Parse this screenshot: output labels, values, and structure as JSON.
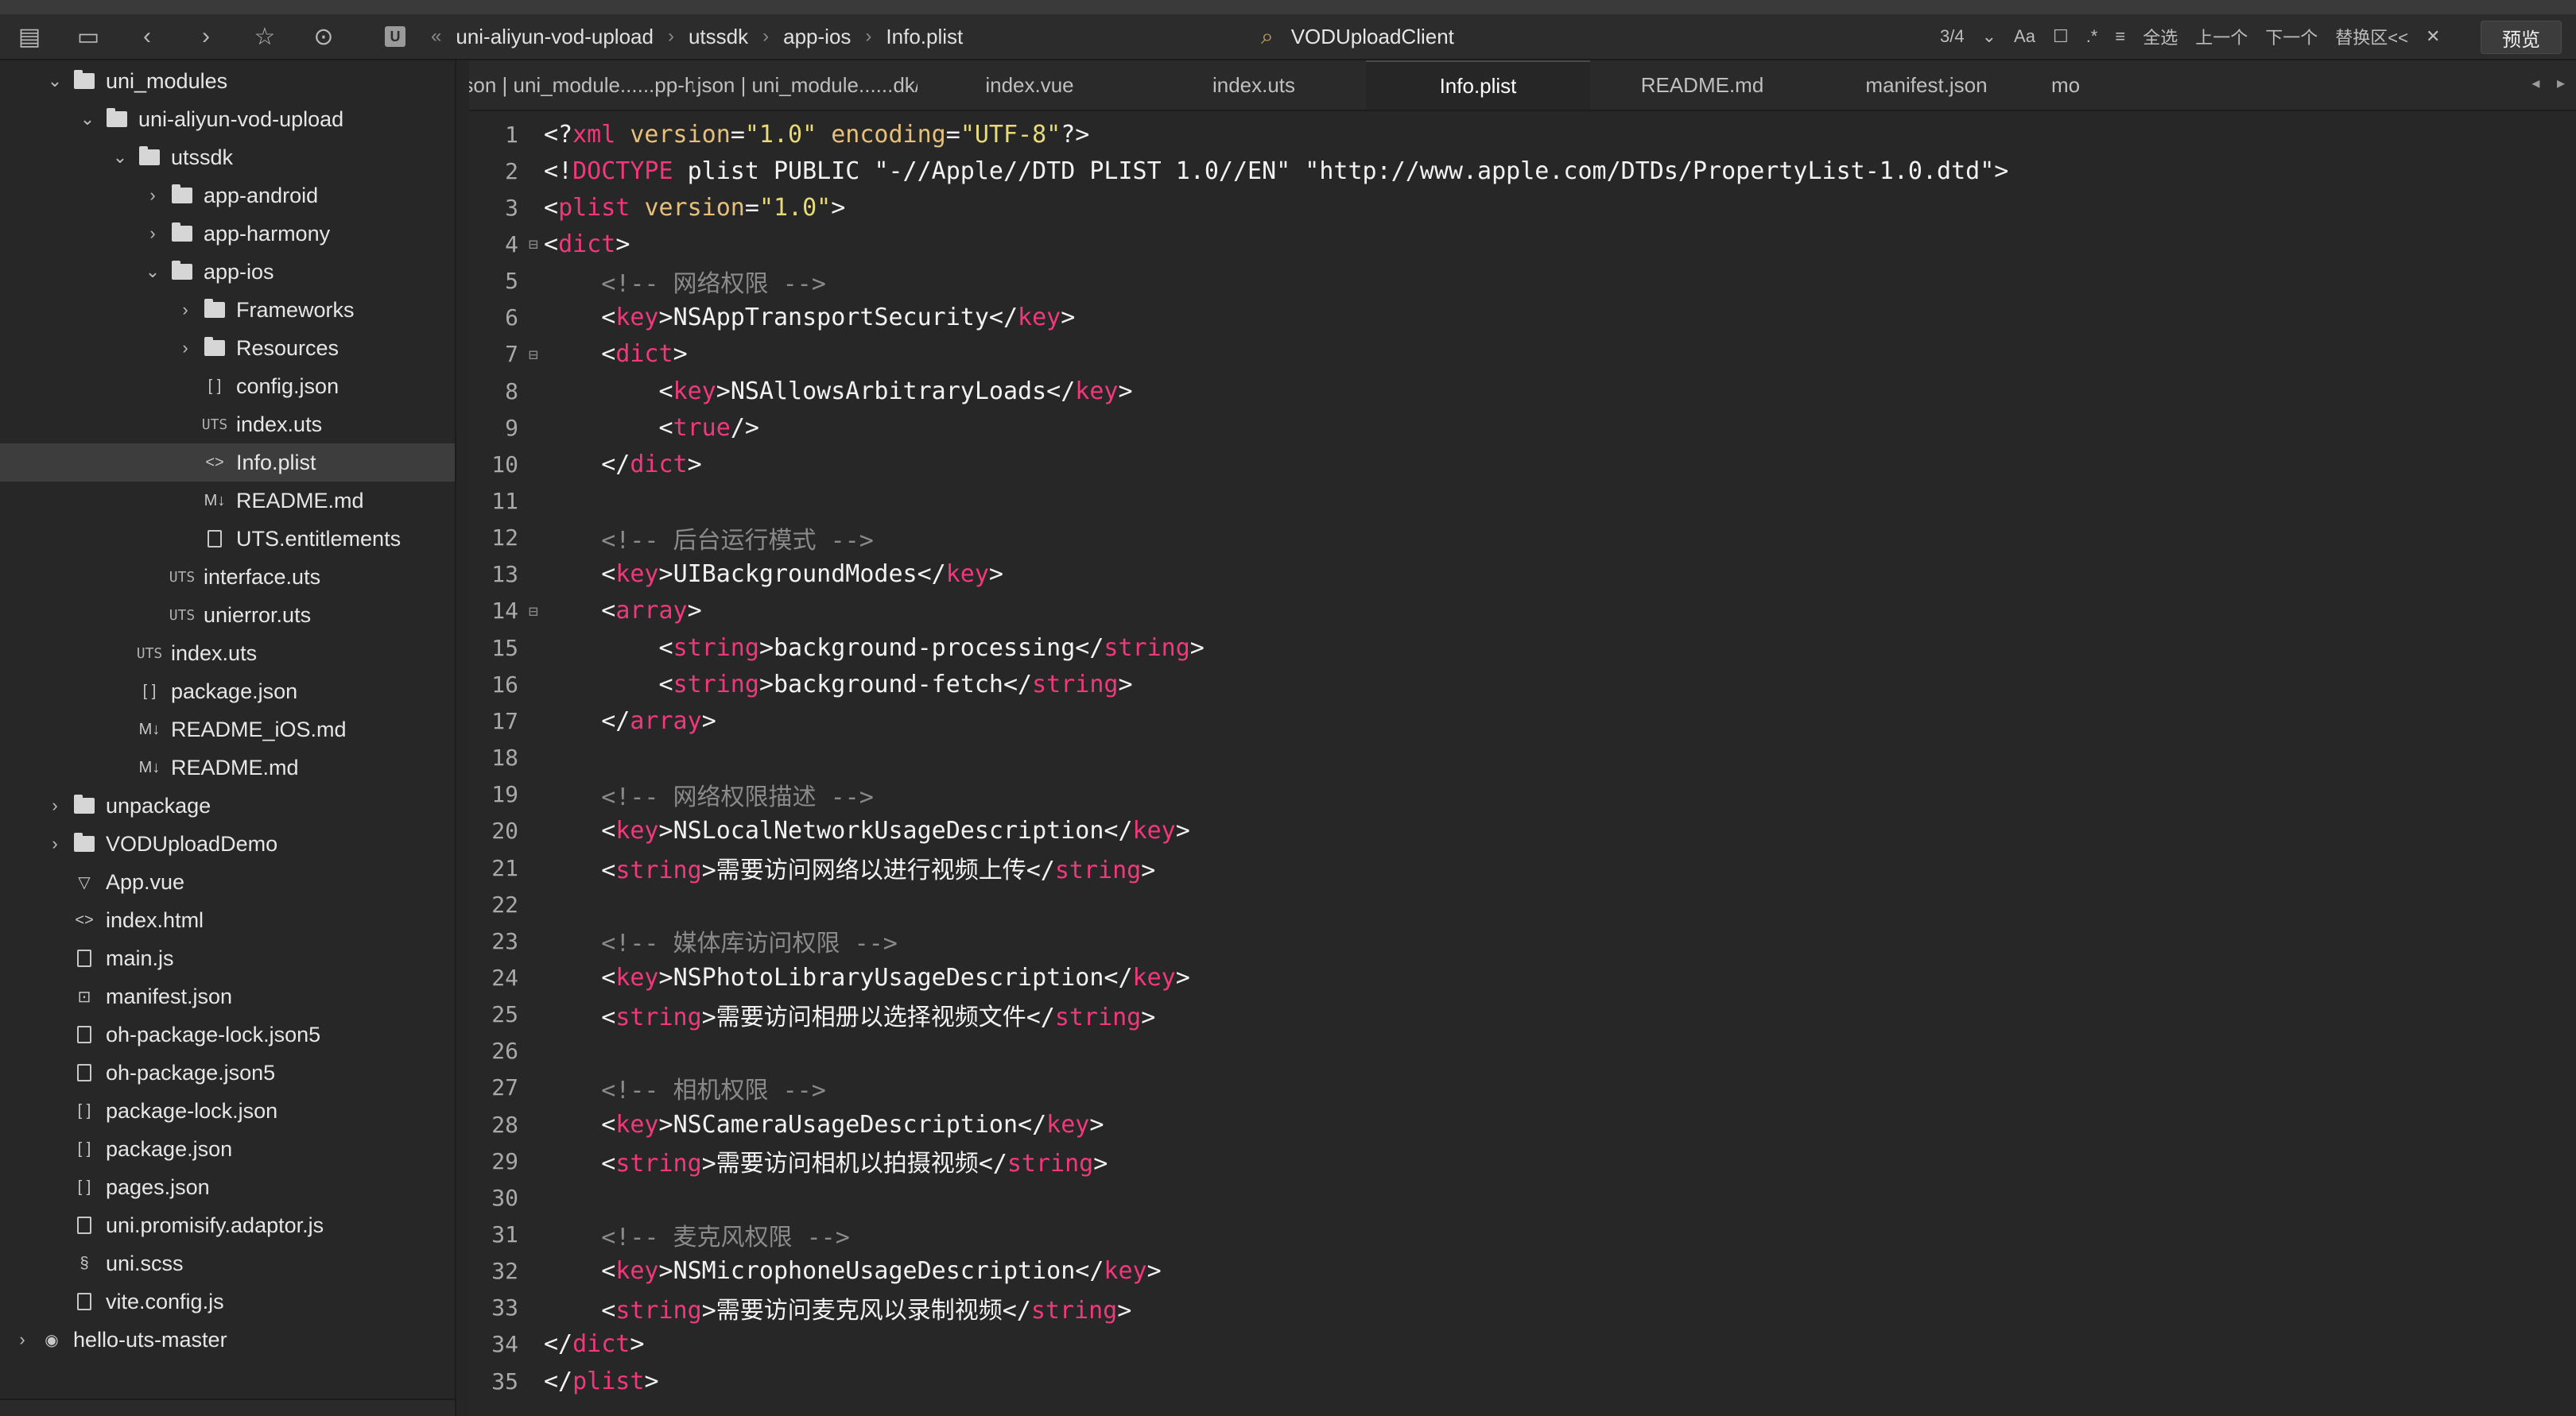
{
  "toolbar": {
    "breadcrumb": [
      "uni-aliyun-vod-upload",
      "utssdk",
      "app-ios",
      "Info.plist"
    ],
    "breadcrumb_logo": "U",
    "search_value": "VODUploadClient",
    "match_count": "3/4",
    "case_label": "Aa",
    "select_all": "全选",
    "prev": "上一个",
    "next": "下一个",
    "replace": "替换区<<",
    "preview": "预览",
    "icons": [
      "outline-icon",
      "save-icon",
      "back-icon",
      "forward-icon",
      "star-icon",
      "run-icon"
    ]
  },
  "sidebar": {
    "items": [
      {
        "label": "uni_modules",
        "depth": 1,
        "type": "folder",
        "open": true
      },
      {
        "label": "uni-aliyun-vod-upload",
        "depth": 2,
        "type": "folder",
        "open": true
      },
      {
        "label": "utssdk",
        "depth": 3,
        "type": "folder",
        "open": true
      },
      {
        "label": "app-android",
        "depth": 4,
        "type": "folder",
        "open": false
      },
      {
        "label": "app-harmony",
        "depth": 4,
        "type": "folder",
        "open": false
      },
      {
        "label": "app-ios",
        "depth": 4,
        "type": "folder",
        "open": true
      },
      {
        "label": "Frameworks",
        "depth": 5,
        "type": "folder",
        "open": false
      },
      {
        "label": "Resources",
        "depth": 5,
        "type": "folder",
        "open": false
      },
      {
        "label": "config.json",
        "depth": 5,
        "type": "json"
      },
      {
        "label": "index.uts",
        "depth": 5,
        "type": "uts"
      },
      {
        "label": "Info.plist",
        "depth": 5,
        "type": "xml",
        "selected": true
      },
      {
        "label": "README.md",
        "depth": 5,
        "type": "md"
      },
      {
        "label": "UTS.entitlements",
        "depth": 5,
        "type": "file"
      },
      {
        "label": "interface.uts",
        "depth": 4,
        "type": "uts"
      },
      {
        "label": "unierror.uts",
        "depth": 4,
        "type": "uts"
      },
      {
        "label": "index.uts",
        "depth": 3,
        "type": "uts"
      },
      {
        "label": "package.json",
        "depth": 3,
        "type": "json"
      },
      {
        "label": "README_iOS.md",
        "depth": 3,
        "type": "md"
      },
      {
        "label": "README.md",
        "depth": 3,
        "type": "md"
      },
      {
        "label": "unpackage",
        "depth": 1,
        "type": "folder",
        "open": false
      },
      {
        "label": "VODUploadDemo",
        "depth": 1,
        "type": "folder",
        "open": false
      },
      {
        "label": "App.vue",
        "depth": 1,
        "type": "vue"
      },
      {
        "label": "index.html",
        "depth": 1,
        "type": "xml"
      },
      {
        "label": "main.js",
        "depth": 1,
        "type": "js"
      },
      {
        "label": "manifest.json",
        "depth": 1,
        "type": "manifest"
      },
      {
        "label": "oh-package-lock.json5",
        "depth": 1,
        "type": "file"
      },
      {
        "label": "oh-package.json5",
        "depth": 1,
        "type": "file"
      },
      {
        "label": "package-lock.json",
        "depth": 1,
        "type": "json"
      },
      {
        "label": "package.json",
        "depth": 1,
        "type": "json"
      },
      {
        "label": "pages.json",
        "depth": 1,
        "type": "json"
      },
      {
        "label": "uni.promisify.adaptor.js",
        "depth": 1,
        "type": "js"
      },
      {
        "label": "uni.scss",
        "depth": 1,
        "type": "scss"
      },
      {
        "label": "vite.config.js",
        "depth": 1,
        "type": "js"
      },
      {
        "label": "hello-uts-master",
        "depth": 0,
        "type": "project",
        "open": false
      }
    ]
  },
  "tabs": [
    {
      "label": "config.json | uni_module......pp-harmony",
      "active": false
    },
    {
      "label": "* config.json | uni_module......dk/app-ios",
      "active": false
    },
    {
      "label": "index.vue",
      "active": false
    },
    {
      "label": "index.uts",
      "active": false
    },
    {
      "label": "Info.plist",
      "active": true
    },
    {
      "label": "README.md",
      "active": false
    },
    {
      "label": "manifest.json",
      "active": false
    },
    {
      "label": "mo",
      "active": false
    }
  ],
  "tab_scroll_arrows": "◂ ▸",
  "code": {
    "lines": [
      "<?xml version=\"1.0\" encoding=\"UTF-8\"?>",
      "<!DOCTYPE plist PUBLIC \"-//Apple//DTD PLIST 1.0//EN\" \"http://www.apple.com/DTDs/PropertyList-1.0.dtd\">",
      "<plist version=\"1.0\">",
      "<dict>",
      "    <!-- 网络权限 -->",
      "    <key>NSAppTransportSecurity</key>",
      "    <dict>",
      "        <key>NSAllowsArbitraryLoads</key>",
      "        <true/>",
      "    </dict>",
      "",
      "    <!-- 后台运行模式 -->",
      "    <key>UIBackgroundModes</key>",
      "    <array>",
      "        <string>background-processing</string>",
      "        <string>background-fetch</string>",
      "    </array>",
      "",
      "    <!-- 网络权限描述 -->",
      "    <key>NSLocalNetworkUsageDescription</key>",
      "    <string>需要访问网络以进行视频上传</string>",
      "",
      "    <!-- 媒体库访问权限 -->",
      "    <key>NSPhotoLibraryUsageDescription</key>",
      "    <string>需要访问相册以选择视频文件</string>",
      "",
      "    <!-- 相机权限 -->",
      "    <key>NSCameraUsageDescription</key>",
      "    <string>需要访问相机以拍摄视频</string>",
      "",
      "    <!-- 麦克风权限 -->",
      "    <key>NSMicrophoneUsageDescription</key>",
      "    <string>需要访问麦克风以录制视频</string>",
      "</dict>",
      "</plist>"
    ],
    "fold_lines": [
      4,
      7,
      14
    ]
  },
  "colors": {
    "tag": "#f0387b",
    "attribute": "#e6c07b",
    "string": "#e6db74",
    "comment": "#8a8a8a",
    "text": "#f2f2f2",
    "background": "#262626"
  }
}
